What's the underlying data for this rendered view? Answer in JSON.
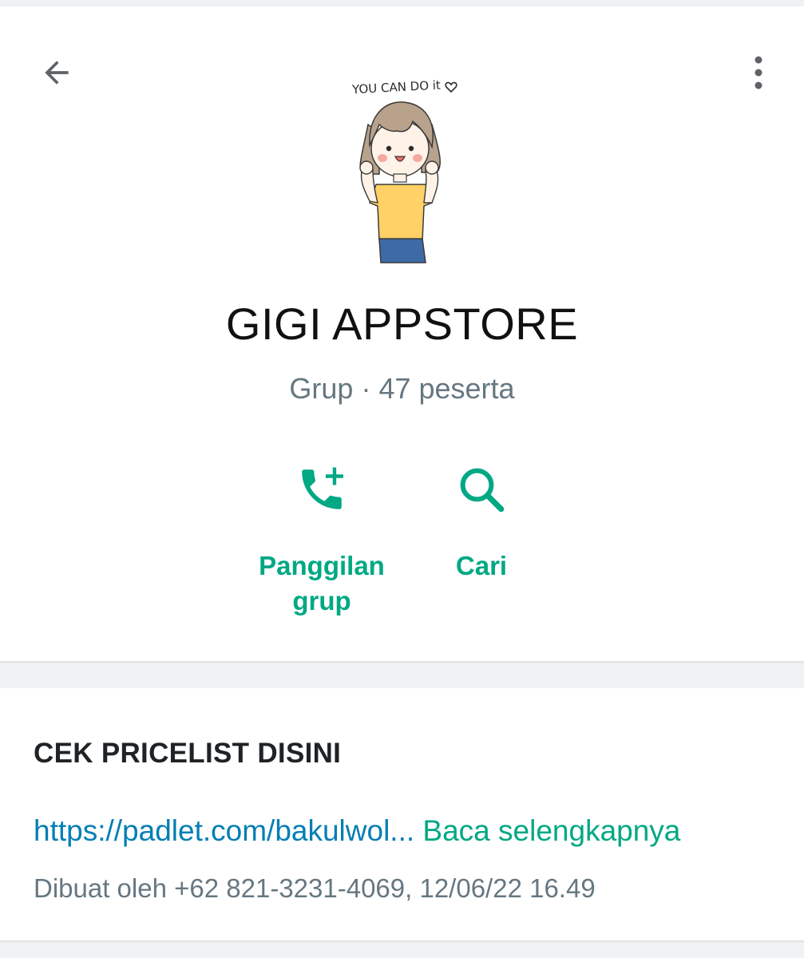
{
  "header": {
    "back_icon": "arrow-left-icon",
    "menu_icon": "more-vertical-icon",
    "avatar_text": "YOU CAN DO it",
    "group_name": "GIGI APPSTORE",
    "group_meta": "Grup · 47 peserta"
  },
  "actions": {
    "call": {
      "icon": "add-call-icon",
      "label_line1": "Panggilan",
      "label_line2": "grup"
    },
    "search": {
      "icon": "search-icon",
      "label": "Cari"
    }
  },
  "description": {
    "title": "CEK PRICELIST DISINI",
    "link": "https://padlet.com/bakulwol...",
    "read_more": "Baca selengkapnya",
    "created": "Dibuat oleh +62 821-3231-4069, 12/06/22 16.49"
  },
  "colors": {
    "accent": "#00a884",
    "link": "#027eb5",
    "muted": "#667781"
  }
}
